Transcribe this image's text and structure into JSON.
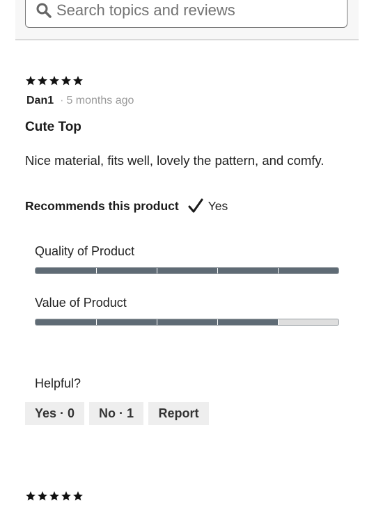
{
  "search": {
    "placeholder": "Search topics and reviews"
  },
  "review": {
    "rating": 5,
    "author": "Dan1",
    "separator": "·",
    "date": "5 months ago",
    "title": "Cute Top",
    "text": "Nice material, fits well, lovely the pattern, and comfy.",
    "recommends_label": "Recommends this product",
    "recommends_value": "Yes",
    "ratings": [
      {
        "label": "Quality of Product",
        "score": 5,
        "max": 5
      },
      {
        "label": "Value of Product",
        "score": 4,
        "max": 5
      }
    ],
    "helpful_label": "Helpful?",
    "buttons": {
      "yes": "Yes · 0",
      "no": "No · 1",
      "report": "Report"
    }
  },
  "next_review": {
    "rating": 5
  },
  "colors": {
    "bar_fill": "#5f6b75",
    "bar_empty": "#dedede",
    "button_bg": "#eeeeee"
  }
}
